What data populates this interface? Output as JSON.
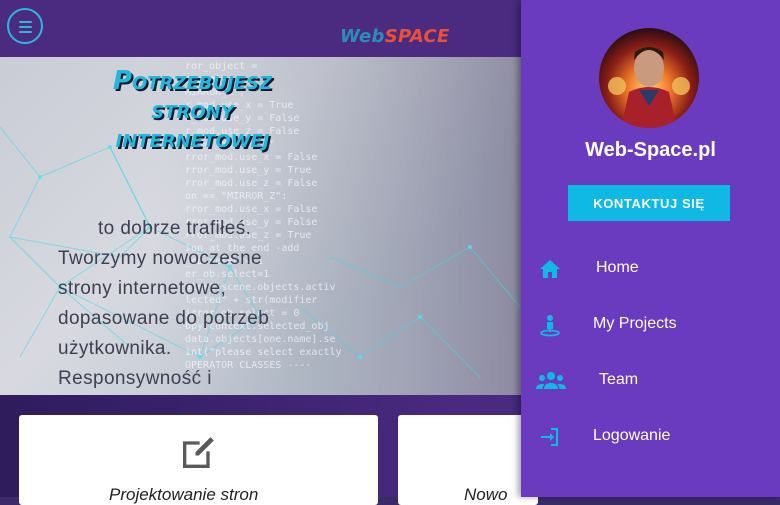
{
  "header": {
    "logo_part1": "Web",
    "logo_part2": "SPACE",
    "menu_icon": "hamburger-menu-icon"
  },
  "hero": {
    "heading_line1": "Potrzebujesz",
    "heading_line2": "strony",
    "heading_line3": "internetowej",
    "text_line1": "to dobrze trafiłeś.",
    "text_line2": "Tworzymy nowoczesne",
    "text_line3": "strony internetowe,",
    "text_line4": "dopasowane do potrzeb",
    "text_line5": "użytkownika.",
    "text_line6": "Responsywność i",
    "code_lines": [
      "ror_object =",
      "operat",
      "MIRROR_X\";",
      "r_mod.use_x = True",
      "r_mod.use_y = False",
      "r_mod.use_z = False",
      "n == \"MIRROR_Y\"",
      "rror_mod.use_x = False",
      "rror_mod.use_y = True",
      "rror_mod.use_z = False",
      "on == \"MIRROR_Z\":",
      "rror_mod.use_x = False",
      "rror_mod.use_y = False",
      "rror_mod.use_z = True",
      "ion at the end -add",
      "_ob.select= 1",
      "er_ob.select=1",
      "ntext.scene.objects.activ",
      "lected\" + str(modifier",
      "irror_ob.select = 0",
      "bpy.context.selected_obj",
      "data.objects[one.name].se",
      "int(\"please select exactly",
      "OPERATOR CLASSES ----"
    ]
  },
  "cards": [
    {
      "title": "Projektowanie stron",
      "icon": "edit-icon"
    },
    {
      "title": "Nowo",
      "icon": "card-icon"
    }
  ],
  "sidebar": {
    "site_name": "Web-Space.pl",
    "contact_label": "KONTAKTUJ SIĘ",
    "avatar_icon": "profile-avatar",
    "items": [
      {
        "label": "Home",
        "icon": "home-icon"
      },
      {
        "label": "My Projects",
        "icon": "person-pin-icon"
      },
      {
        "label": "Team",
        "icon": "group-icon"
      },
      {
        "label": "Logowanie",
        "icon": "login-icon"
      }
    ],
    "accent": "#10b9e4",
    "background": "#6a3abf"
  }
}
